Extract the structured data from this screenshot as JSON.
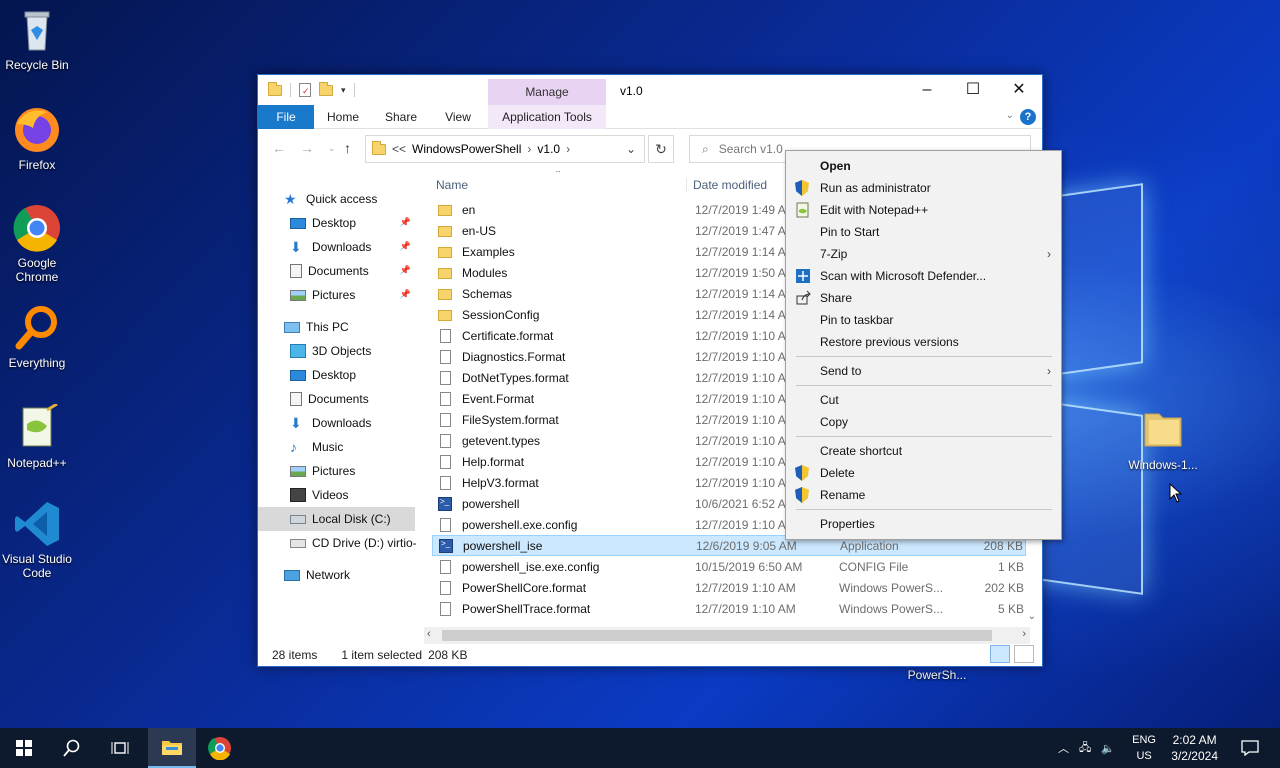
{
  "desktop": {
    "icons": [
      {
        "label": "Recycle Bin"
      },
      {
        "label": "Firefox"
      },
      {
        "label": "Google Chrome"
      },
      {
        "label": "Everything"
      },
      {
        "label": "Notepad++"
      },
      {
        "label": "Visual Studio Code"
      },
      {
        "label": "Windows-1..."
      },
      {
        "label": "PowerSh..."
      }
    ]
  },
  "explorer": {
    "title": "v1.0",
    "manage_tab": "Manage",
    "ribbon_tabs": [
      "File",
      "Home",
      "Share",
      "View",
      "Application Tools"
    ],
    "address": {
      "prefix": "<<",
      "crumbs": [
        "WindowsPowerShell",
        "v1.0"
      ]
    },
    "search_placeholder": "Search v1.0",
    "nav": {
      "quick_access": "Quick access",
      "quick_items": [
        "Desktop",
        "Downloads",
        "Documents",
        "Pictures"
      ],
      "this_pc": "This PC",
      "pc_items": [
        "3D Objects",
        "Desktop",
        "Documents",
        "Downloads",
        "Music",
        "Pictures",
        "Videos",
        "Local Disk (C:)",
        "CD Drive (D:) virtio-"
      ],
      "network": "Network"
    },
    "columns": {
      "name": "Name",
      "date": "Date modified"
    },
    "files": [
      {
        "name": "en",
        "date": "12/7/2019 1:49 A",
        "type": "",
        "size": "",
        "kind": "folder"
      },
      {
        "name": "en-US",
        "date": "12/7/2019 1:47 A",
        "type": "",
        "size": "",
        "kind": "folder"
      },
      {
        "name": "Examples",
        "date": "12/7/2019 1:14 A",
        "type": "",
        "size": "",
        "kind": "folder"
      },
      {
        "name": "Modules",
        "date": "12/7/2019 1:50 A",
        "type": "",
        "size": "",
        "kind": "folder"
      },
      {
        "name": "Schemas",
        "date": "12/7/2019 1:14 A",
        "type": "",
        "size": "",
        "kind": "folder"
      },
      {
        "name": "SessionConfig",
        "date": "12/7/2019 1:14 A",
        "type": "",
        "size": "",
        "kind": "folder"
      },
      {
        "name": "Certificate.format",
        "date": "12/7/2019 1:10 A",
        "type": "",
        "size": "",
        "kind": "doc"
      },
      {
        "name": "Diagnostics.Format",
        "date": "12/7/2019 1:10 A",
        "type": "",
        "size": "",
        "kind": "doc"
      },
      {
        "name": "DotNetTypes.format",
        "date": "12/7/2019 1:10 A",
        "type": "",
        "size": "",
        "kind": "doc"
      },
      {
        "name": "Event.Format",
        "date": "12/7/2019 1:10 A",
        "type": "",
        "size": "",
        "kind": "doc"
      },
      {
        "name": "FileSystem.format",
        "date": "12/7/2019 1:10 A",
        "type": "",
        "size": "",
        "kind": "doc"
      },
      {
        "name": "getevent.types",
        "date": "12/7/2019 1:10 A",
        "type": "",
        "size": "",
        "kind": "doc"
      },
      {
        "name": "Help.format",
        "date": "12/7/2019 1:10 A",
        "type": "",
        "size": "",
        "kind": "doc"
      },
      {
        "name": "HelpV3.format",
        "date": "12/7/2019 1:10 A",
        "type": "",
        "size": "",
        "kind": "doc"
      },
      {
        "name": "powershell",
        "date": "10/6/2021 6:52 A",
        "type": "",
        "size": "",
        "kind": "ps"
      },
      {
        "name": "powershell.exe.config",
        "date": "12/7/2019 1:10 A",
        "type": "",
        "size": "",
        "kind": "doc"
      },
      {
        "name": "powershell_ise",
        "date": "12/6/2019 9:05 AM",
        "type": "Application",
        "size": "208 KB",
        "kind": "ps"
      },
      {
        "name": "powershell_ise.exe.config",
        "date": "10/15/2019 6:50 AM",
        "type": "CONFIG File",
        "size": "1 KB",
        "kind": "doc"
      },
      {
        "name": "PowerShellCore.format",
        "date": "12/7/2019 1:10 AM",
        "type": "Windows PowerS...",
        "size": "202 KB",
        "kind": "doc"
      },
      {
        "name": "PowerShellTrace.format",
        "date": "12/7/2019 1:10 AM",
        "type": "Windows PowerS...",
        "size": "5 KB",
        "kind": "doc"
      }
    ],
    "status": {
      "count": "28 items",
      "selected": "1 item selected",
      "size": "208 KB"
    }
  },
  "context_menu": {
    "items": [
      {
        "label": "Open",
        "icon": "none",
        "bold": true
      },
      {
        "label": "Run as administrator",
        "icon": "shield-icon"
      },
      {
        "label": "Edit with Notepad++",
        "icon": "notepad-icon"
      },
      {
        "label": "Pin to Start",
        "icon": "none"
      },
      {
        "label": "7-Zip",
        "icon": "none",
        "submenu": true
      },
      {
        "label": "Scan with Microsoft Defender...",
        "icon": "defender-icon"
      },
      {
        "label": "Share",
        "icon": "share-icon"
      },
      {
        "label": "Pin to taskbar",
        "icon": "none"
      },
      {
        "label": "Restore previous versions",
        "icon": "none"
      },
      {
        "label": "Send to",
        "icon": "none",
        "submenu": true
      },
      {
        "label": "Cut",
        "icon": "none"
      },
      {
        "label": "Copy",
        "icon": "none"
      },
      {
        "label": "Create shortcut",
        "icon": "none"
      },
      {
        "label": "Delete",
        "icon": "shield-icon"
      },
      {
        "label": "Rename",
        "icon": "shield-icon"
      },
      {
        "label": "Properties",
        "icon": "none"
      }
    ]
  },
  "taskbar": {
    "lang_top": "ENG",
    "lang_bottom": "US",
    "time": "2:02 AM",
    "date": "3/2/2024"
  }
}
